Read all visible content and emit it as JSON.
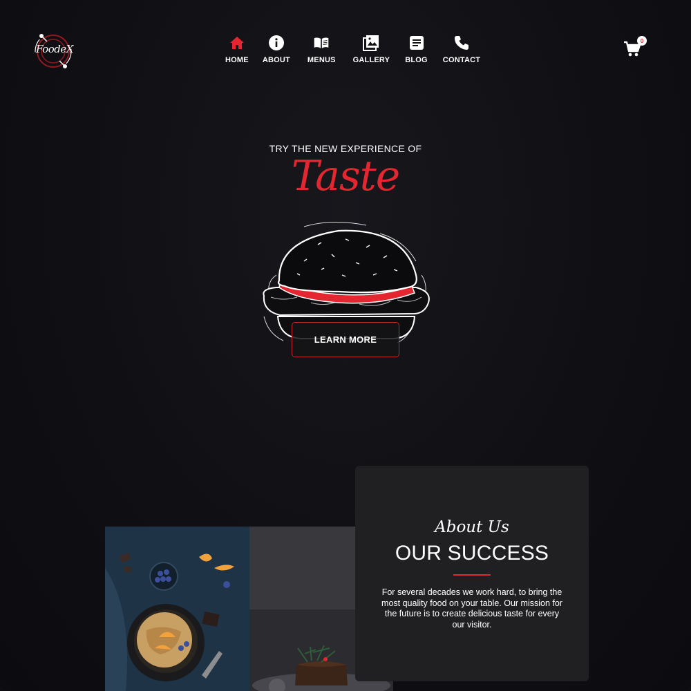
{
  "brand": {
    "logo_text": "FoodeX"
  },
  "nav": {
    "items": [
      {
        "label": "HOME",
        "icon": "home-icon",
        "active": true
      },
      {
        "label": "ABOUT",
        "icon": "info-icon",
        "active": false
      },
      {
        "label": "MENUS",
        "icon": "book-icon",
        "active": false
      },
      {
        "label": "GALLERY",
        "icon": "gallery-icon",
        "active": false
      },
      {
        "label": "BLOG",
        "icon": "document-icon",
        "active": false
      },
      {
        "label": "CONTACT",
        "icon": "phone-icon",
        "active": false
      }
    ],
    "active_color": "#e3262f",
    "inactive_color": "#ffffff"
  },
  "cart": {
    "icon": "cart-icon",
    "count": "0"
  },
  "hero": {
    "kicker": "TRY THE NEW EXPERIENCE OF",
    "title": "Taste",
    "illustration": "burger-illustration",
    "cta_label": "LEARN MORE"
  },
  "about": {
    "kicker": "About Us",
    "title": "OUR SUCCESS",
    "text": "For several decades we work hard, to bring the most quality food on your table. Our mission for the future is to create delicious taste for every our visitor.",
    "photos": [
      "pancake-skillet-photo",
      "chocolate-cake-photo"
    ]
  },
  "colors": {
    "accent": "#e3262f",
    "background": "#0f0f13",
    "card": "#202023"
  }
}
